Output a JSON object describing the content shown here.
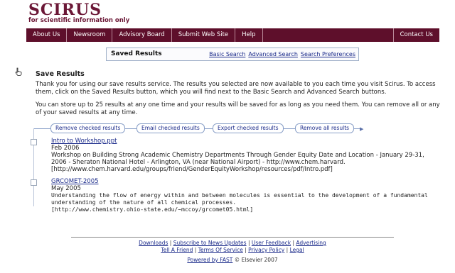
{
  "logo": {
    "word": "SCIRUS",
    "tagline": "for scientific information only"
  },
  "nav": {
    "items": [
      "About Us",
      "Newsroom",
      "Advisory Board",
      "Submit Web Site",
      "Help"
    ],
    "right": "Contact Us"
  },
  "saved_box": {
    "title": "Saved Results",
    "links": [
      "Basic Search",
      "Advanced Search",
      "Search Preferences"
    ]
  },
  "main": {
    "heading": "Save Results",
    "para1": "Thank you for using our save results service. The results you selected are now available to you each time you visit Scirus. To access them, click on the Saved Results button, which you will find next to the Basic Search and Advanced Search buttons.",
    "para2": "You can store up to 25 results at any one time and your results will be saved for as long as you need them. You can remove all or any of your saved results at any time."
  },
  "actions": [
    "Remove checked results",
    "Email checked results",
    "Export checked results",
    "Remove all results"
  ],
  "results": [
    {
      "title": "Intro to Workshop.ppt",
      "date": "Feb 2006",
      "desc": "Workshop on Building Strong Academic Chemistry Departments Through Gender Equity Date and Location - January 29-31, 2006 - Sheraton National Hotel - Arlington, VA (near National Airport) - http://www.chem.harvard.",
      "url": "[http://www.chem.harvard.edu/groups/friend/GenderEquityWorkshop/resources/pdf/Intro.pdf]"
    },
    {
      "title": "GRCOMET-2005",
      "date": "May 2005",
      "desc": "Understanding the flow of energy within and between molecules is essential to the development of a fundamental understanding of the nature of all chemical processes.",
      "url": "[http://www.chemistry.ohio-state.edu/~mccoy/grcomet05.html]"
    }
  ],
  "footer": {
    "row1": [
      "Downloads",
      "Subscribe to News Updates",
      "User Feedback",
      "Advertising"
    ],
    "row2": [
      "Tell A Friend",
      "Terms Of Service",
      "Privacy Policy",
      "Legal"
    ],
    "powered_link": "Powered by FAST",
    "copyright": "© Elsevier 2007"
  },
  "colors": {
    "brand": "#5e0f2b",
    "link": "#1a2a8a",
    "action_border": "#8aa0c8"
  },
  "icons": {
    "pointer": "hand-pointer-icon",
    "arrow": "arrow-right-icon"
  }
}
